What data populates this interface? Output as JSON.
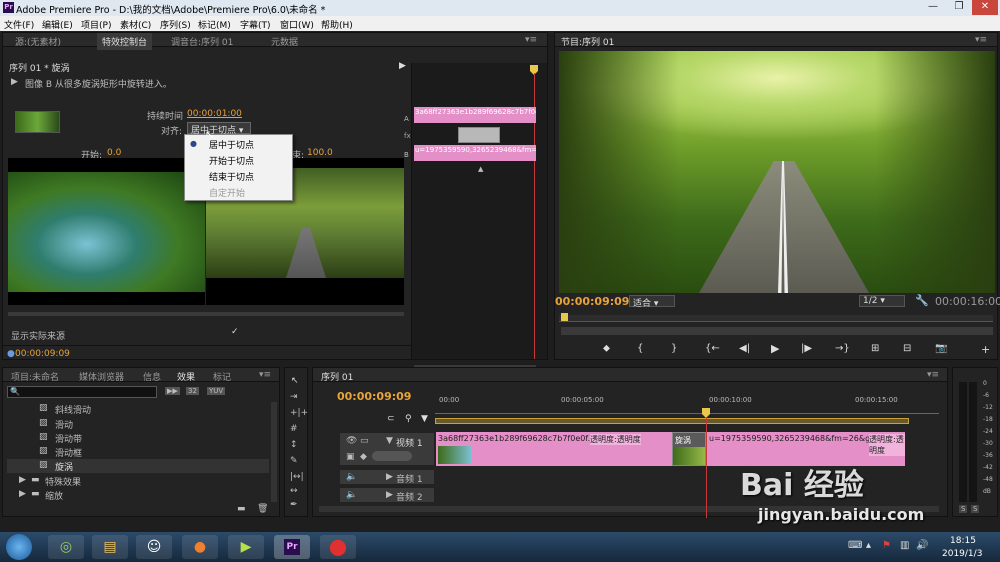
{
  "window": {
    "title": "Adobe Premiere Pro - D:\\我的文档\\Adobe\\Premiere Pro\\6.0\\未命名 *",
    "min": "—",
    "max": "❐",
    "close": "✕"
  },
  "menu": [
    "文件(F)",
    "编辑(E)",
    "项目(P)",
    "素材(C)",
    "序列(S)",
    "标记(M)",
    "字幕(T)",
    "窗口(W)",
    "帮助(H)"
  ],
  "source_panel": {
    "tabs": [
      "源:(无素材)",
      "特效控制台",
      "调音台:序列 01",
      "元数据"
    ],
    "header": "序列 01 * 旋涡",
    "description": "图像 B 从很多旋涡矩形中旋转进入。",
    "duration_label": "持续时间",
    "duration_value": "00:00:01:00",
    "align_label": "对齐:",
    "align_value": "居中于切点",
    "start_label": "开始:",
    "start_value": "0.0",
    "end_label": "结束:",
    "end_value": "100.0",
    "show_actual": "显示实际来源",
    "timecode": "00:00:09:09",
    "track_a": "A",
    "track_b": "B",
    "clip_a": "3a68ff27363e1b289f69628c7b7f0e0f.jpg",
    "clip_b": "u=1975359590,3265239468&fm=26&gp=0.jpg"
  },
  "dropdown": {
    "items": [
      "居中于切点",
      "开始于切点",
      "结束于切点",
      "自定开始"
    ],
    "selected": 0
  },
  "program_panel": {
    "tab": "节目:序列 01",
    "timecode": "00:00:09:09",
    "fit": "适合",
    "scale": "1/2",
    "duration": "00:00:16:00"
  },
  "project_panel": {
    "tabs": [
      "项目:未命名",
      "媒体浏览器",
      "信息",
      "效果",
      "标记"
    ],
    "icons_text": [
      "32",
      "YUV"
    ],
    "items": [
      "斜线滑动",
      "滑动",
      "滑动带",
      "滑动框",
      "旋涡",
      "特殊效果",
      "缩放"
    ]
  },
  "timeline": {
    "tab": "序列 01",
    "timecode": "00:00:09:09",
    "ruler": [
      "00:00",
      "00:00:05:00",
      "00:00:10:00",
      "00:00:15:00"
    ],
    "tracks": [
      "视频 1",
      "音频 1",
      "音频 2"
    ],
    "clip1": "3a68ff27363e1b289f69628c7b7f0e0f.jpg",
    "clip1_fx": "透明度:透明度",
    "transition": "旋涡",
    "clip2": "u=1975359590,3265239468&fm=26&gp=0.jpg",
    "clip2_fx": "透明度:透明度"
  },
  "meter": {
    "labels": [
      "0",
      "-6",
      "-12",
      "-18",
      "-24",
      "-30",
      "-36",
      "-42",
      "-48",
      "dB"
    ],
    "solo": [
      "S",
      "S"
    ]
  },
  "taskbar": {
    "time": "18:15",
    "date": "2019/1/3"
  },
  "watermark": {
    "logo": "Bai 经验",
    "url": "jingyan.baidu.com"
  }
}
